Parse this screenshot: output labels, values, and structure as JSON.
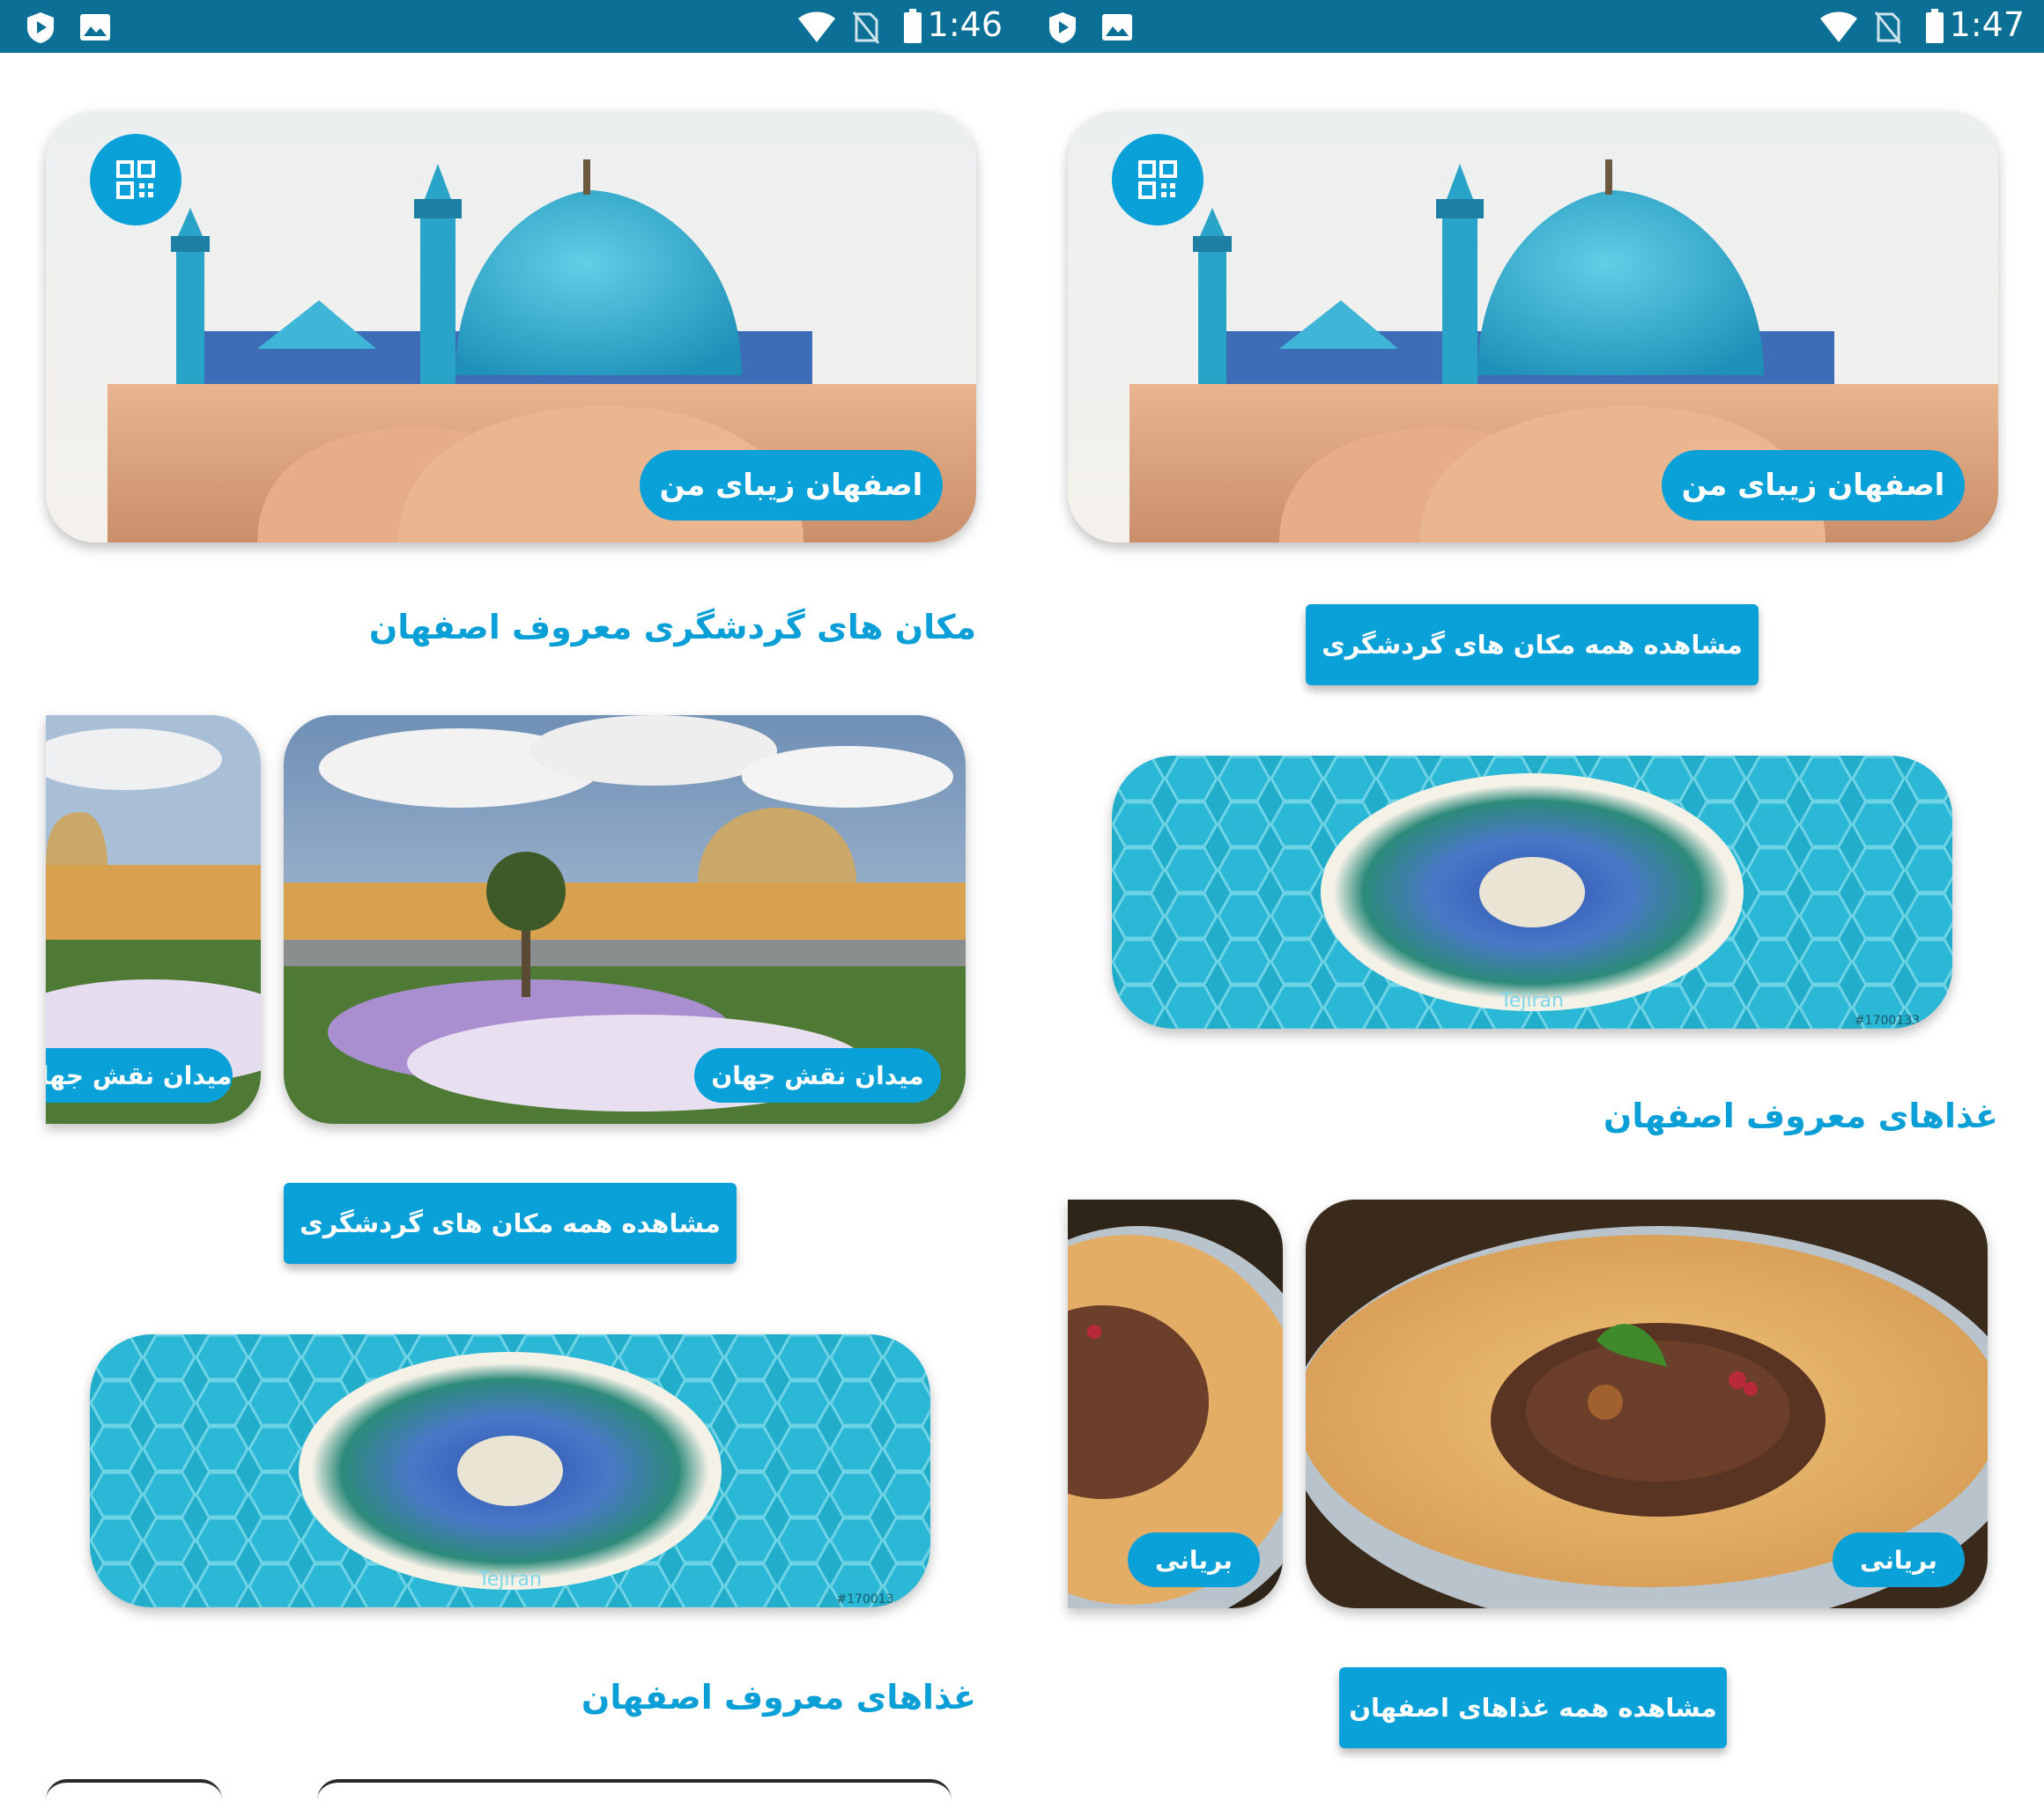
{
  "screens": [
    {
      "status": {
        "time": "1:46"
      },
      "hero": {
        "title": "اصفهان زیبای من",
        "qr_icon": "qr-code-icon"
      },
      "places": {
        "heading": "مکان های گردشگری معروف اصفهان",
        "items": [
          {
            "label": "میدان نقش جهان"
          },
          {
            "label": "میدان نقش جهان"
          }
        ],
        "view_all": "مشاهده همه مکان های گردشگری"
      },
      "banner": {
        "watermark": "Tejiran",
        "code": "#170013"
      },
      "foods": {
        "heading": "غذاهای معروف اصفهان"
      }
    },
    {
      "status": {
        "time": "1:47"
      },
      "hero": {
        "title": "اصفهان زیبای من",
        "qr_icon": "qr-code-icon"
      },
      "places": {
        "view_all": "مشاهده همه مکان های گردشگری"
      },
      "banner": {
        "watermark": "Tejiran",
        "code": "#1700133"
      },
      "foods": {
        "heading": "غذاهای معروف اصفهان",
        "items": [
          {
            "label": "بریانی"
          },
          {
            "label": "بریانی"
          }
        ],
        "view_all": "مشاهده همه غذاهای اصفهان"
      }
    }
  ],
  "colors": {
    "status_bar": "#0b6f96",
    "accent": "#0aa0d8",
    "heading": "#0a9fd6"
  }
}
